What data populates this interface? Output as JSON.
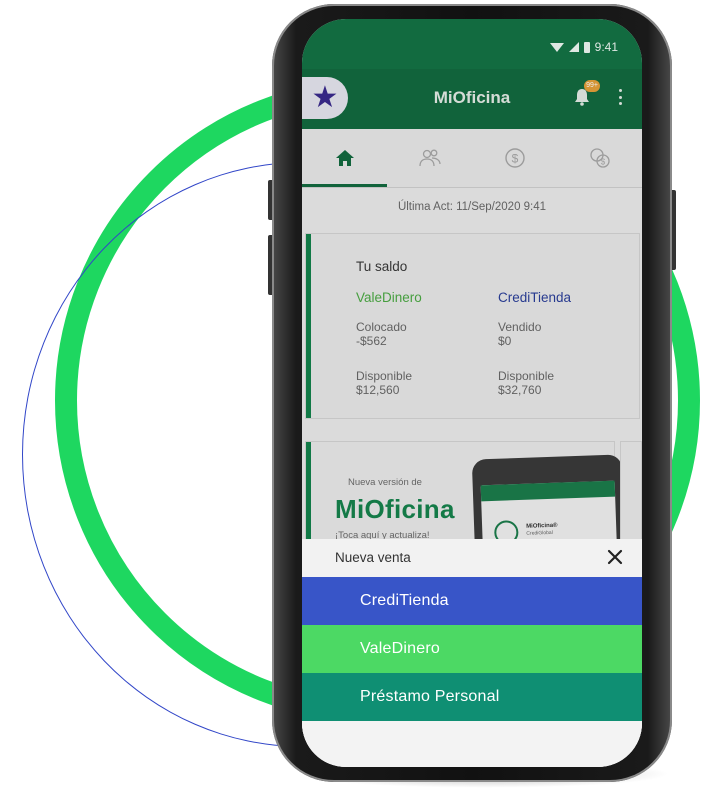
{
  "status_bar": {
    "time": "9:41"
  },
  "app_bar": {
    "title": "MiOficina",
    "notification_badge": "99+"
  },
  "tabs": [
    {
      "icon": "home-icon",
      "active": true
    },
    {
      "icon": "people-icon",
      "active": false
    },
    {
      "icon": "dollar-icon",
      "active": false
    },
    {
      "icon": "coins-icon",
      "active": false
    }
  ],
  "last_update": "Última Act: 11/Sep/2020 9:41",
  "balance": {
    "title": "Tu saldo",
    "vale": {
      "brand": "ValeDinero",
      "placed_label": "Colocado",
      "placed_value": "-$562",
      "available_label": "Disponible",
      "available_value": "$12,560"
    },
    "credi": {
      "brand": "CrediTienda",
      "sold_label": "Vendido",
      "sold_value": "$0",
      "available_label": "Disponible",
      "available_value": "$32,760"
    }
  },
  "promo": {
    "small": "Nueva versión de",
    "big": "MiOficina",
    "cta": "¡Toca aquí y actualiza!",
    "mini_title": "MiOficina®",
    "mini_sub": "CrediGlobal"
  },
  "sheet": {
    "title": "Nueva venta",
    "options": [
      "CrediTienda",
      "ValeDinero",
      "Préstamo Personal"
    ]
  },
  "colors": {
    "app_green": "#136c41",
    "ring_green": "#1ed760",
    "credi_blue": "#3855c8",
    "vale_green": "#4cd964",
    "prestamo_teal": "#0f8f73"
  }
}
